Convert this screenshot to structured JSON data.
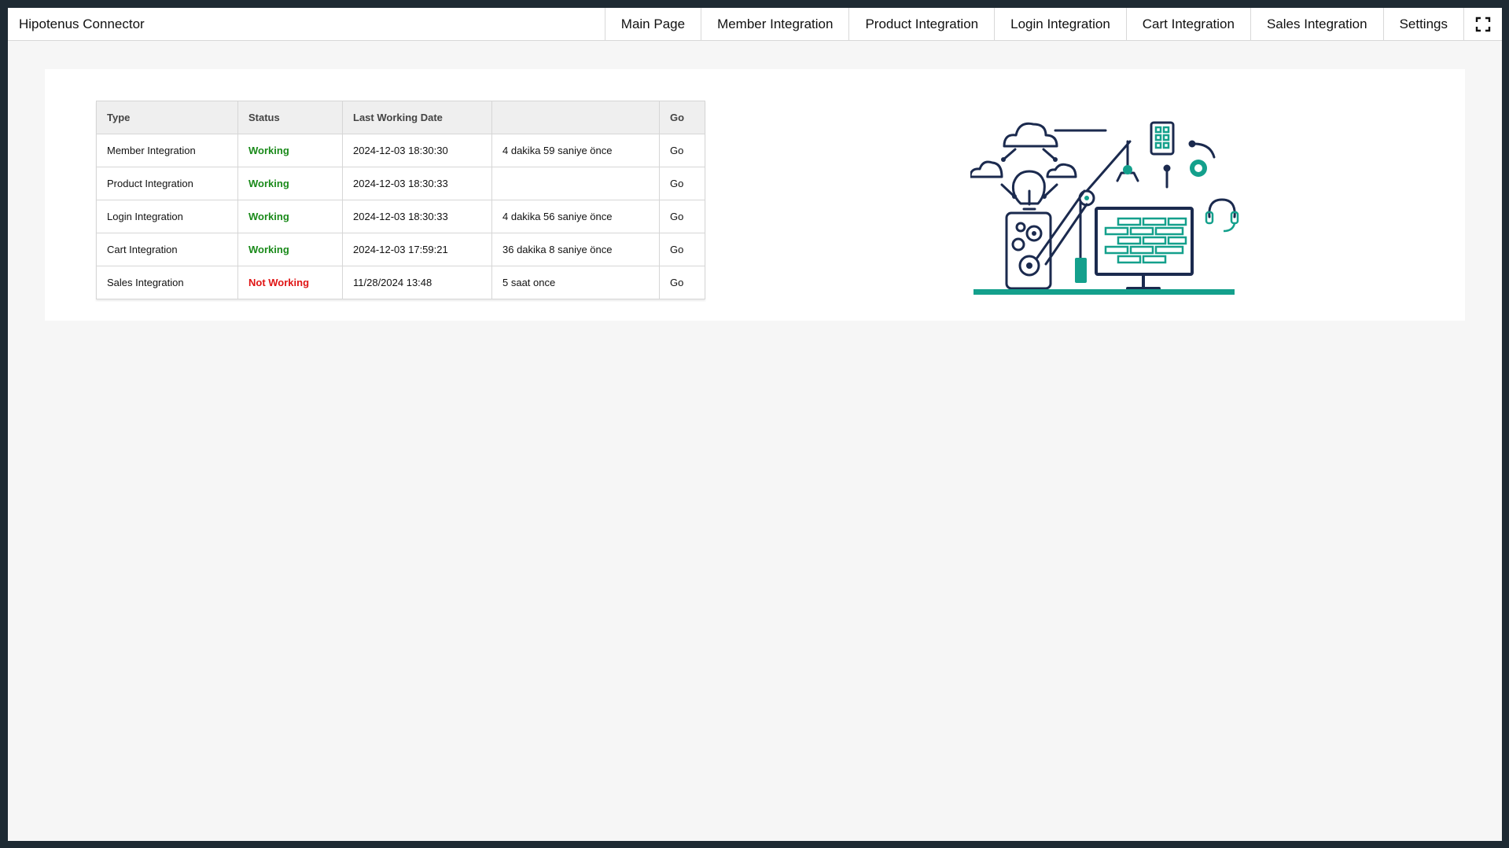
{
  "app": {
    "title": "Hipotenus Connector"
  },
  "nav": {
    "items": [
      {
        "label": "Main Page"
      },
      {
        "label": "Member Integration"
      },
      {
        "label": "Product Integration"
      },
      {
        "label": "Login Integration"
      },
      {
        "label": "Cart Integration"
      },
      {
        "label": "Sales Integration"
      },
      {
        "label": "Settings"
      }
    ],
    "fullscreen_icon": "fullscreen-icon"
  },
  "table": {
    "headers": {
      "type": "Type",
      "status": "Status",
      "last_working_date": "Last Working Date",
      "elapsed": "",
      "go": "Go"
    },
    "rows": [
      {
        "type": "Member Integration",
        "status": "Working",
        "status_kind": "ok",
        "date": "2024-12-03 18:30:30",
        "elapsed": "4 dakika 59 saniye önce",
        "go": "Go"
      },
      {
        "type": "Product Integration",
        "status": "Working",
        "status_kind": "ok",
        "date": "2024-12-03 18:30:33",
        "elapsed": "",
        "go": "Go"
      },
      {
        "type": "Login Integration",
        "status": "Working",
        "status_kind": "ok",
        "date": "2024-12-03 18:30:33",
        "elapsed": "4 dakika 56 saniye önce",
        "go": "Go"
      },
      {
        "type": "Cart Integration",
        "status": "Working",
        "status_kind": "ok",
        "date": "2024-12-03 17:59:21",
        "elapsed": "36 dakika 8 saniye önce",
        "go": "Go"
      },
      {
        "type": "Sales Integration",
        "status": "Not Working",
        "status_kind": "bad",
        "date": "11/28/2024 13:48",
        "elapsed": "5 saat once",
        "go": "Go"
      }
    ]
  },
  "colors": {
    "working": "#1a8a1a",
    "not_working": "#e01515",
    "illustration_navy": "#1b2a4e",
    "illustration_teal": "#14a08c"
  },
  "illustration": {
    "icon": "integration-illustration"
  }
}
